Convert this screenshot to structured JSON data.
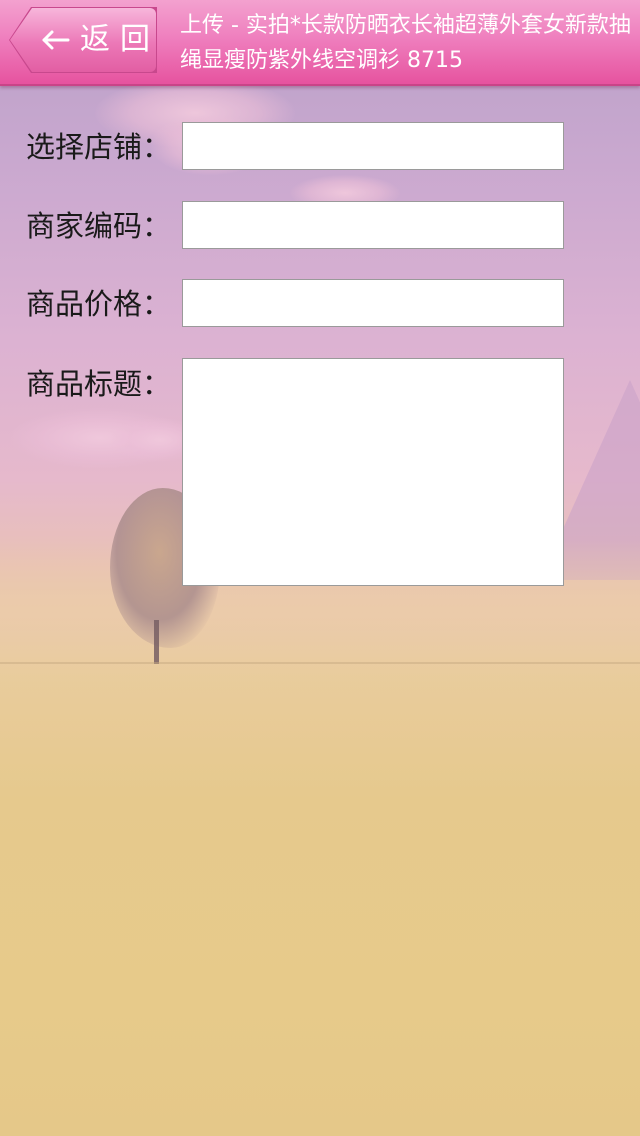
{
  "header": {
    "back_label": "返回",
    "title": "上传 - 实拍*长款防晒衣长袖超薄外套女新款抽绳显瘦防紫外线空调衫 8715"
  },
  "form": {
    "shop_label": "选择店铺：",
    "shop_value": "",
    "code_label": "商家编码：",
    "code_value": "",
    "price_label": "商品价格：",
    "price_value": "",
    "title_label": "商品标题：",
    "title_value": ""
  },
  "icons": {
    "back": "arrow-left-icon"
  },
  "colors": {
    "header_accent": "#ec78b7",
    "header_border": "#c8488d",
    "text": "#1a1a1a"
  }
}
